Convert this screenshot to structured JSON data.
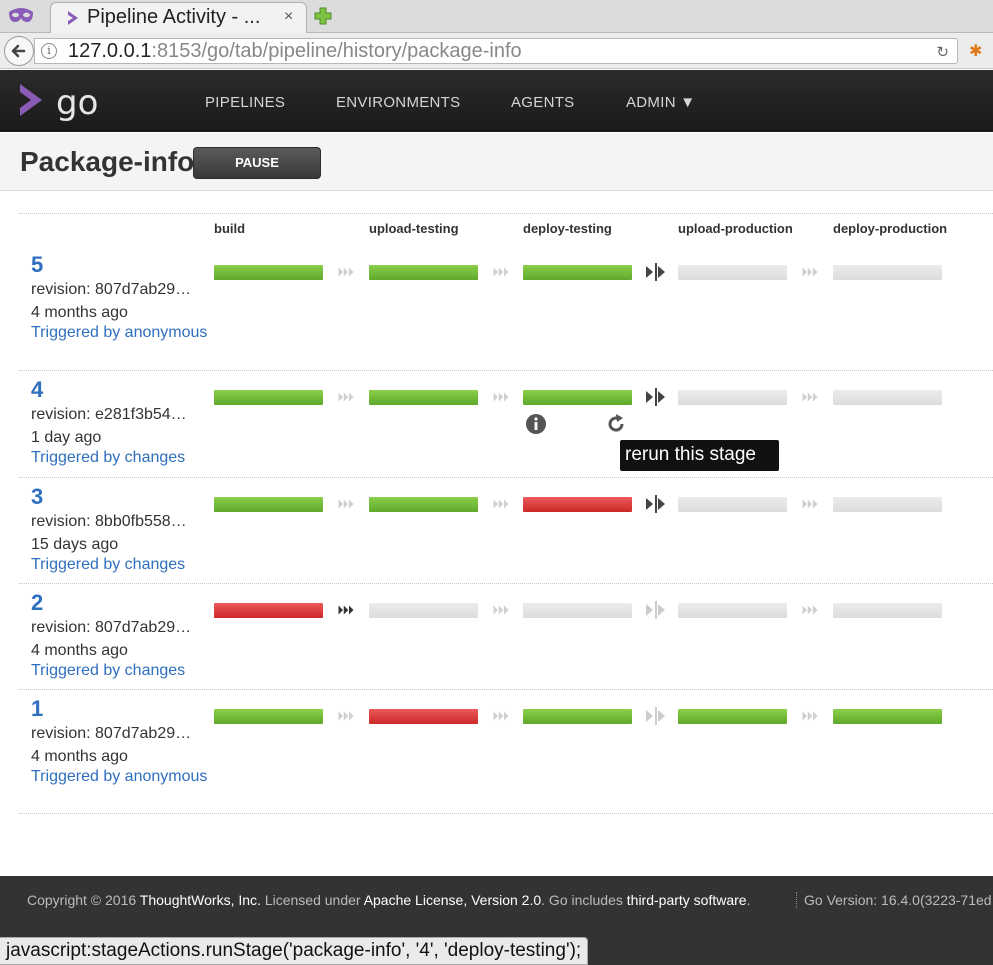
{
  "browser": {
    "tab_title": "Pipeline Activity - ...",
    "tab_close": "×",
    "url_host": "127.0.0.1",
    "url_rest": ":8153/go/tab/pipeline/history/package-info",
    "status_url": "javascript:stageActions.runStage('package-info', '4', 'deploy-testing');"
  },
  "header": {
    "logo_text": "go",
    "nav": [
      "PIPELINES",
      "ENVIRONMENTS",
      "AGENTS",
      "ADMIN ▼"
    ]
  },
  "page": {
    "title": "Package-info",
    "pause_label": "PAUSE"
  },
  "stages": [
    "build",
    "upload-testing",
    "deploy-testing",
    "upload-production",
    "deploy-production"
  ],
  "runs": [
    {
      "counter": "5",
      "revision": "revision: 807d7ab29…",
      "ago": "4 months ago",
      "triggered": "Triggered by anonymous",
      "results": [
        "passed",
        "passed",
        "passed",
        "pending",
        "pending"
      ],
      "arrows": [
        "auto",
        "auto",
        "manual",
        "auto"
      ]
    },
    {
      "counter": "4",
      "revision": "revision: e281f3b54…",
      "ago": "1 day ago",
      "triggered": "Triggered by changes",
      "results": [
        "passed",
        "passed",
        "passed",
        "pending",
        "pending"
      ],
      "arrows": [
        "auto",
        "auto",
        "manual",
        "auto"
      ]
    },
    {
      "counter": "3",
      "revision": "revision: 8bb0fb558…",
      "ago": "15 days ago",
      "triggered": "Triggered by changes",
      "results": [
        "passed",
        "passed",
        "failed",
        "pending",
        "pending"
      ],
      "arrows": [
        "auto",
        "auto",
        "manual",
        "auto"
      ]
    },
    {
      "counter": "2",
      "revision": "revision: 807d7ab29…",
      "ago": "4 months ago",
      "triggered": "Triggered by changes",
      "results": [
        "failed",
        "pending",
        "pending",
        "pending",
        "pending"
      ],
      "arrows": [
        "auto-active",
        "auto",
        "manual-faded",
        "auto"
      ]
    },
    {
      "counter": "1",
      "revision": "revision: 807d7ab29…",
      "ago": "4 months ago",
      "triggered": "Triggered by anonymous",
      "results": [
        "passed",
        "failed",
        "passed",
        "passed",
        "passed"
      ],
      "arrows": [
        "auto",
        "auto",
        "manual-faded",
        "auto"
      ]
    }
  ],
  "tooltip": {
    "text": "rerun this stage"
  },
  "footer": {
    "copyright": "Copyright © 2016 ",
    "company": "ThoughtWorks, Inc.",
    "licensed": " Licensed under ",
    "license": "Apache License, Version 2.0",
    "includes": ". Go includes ",
    "third_party": "third-party software",
    "period": ".",
    "version": "Go Version: 16.4.0(3223-71ed"
  },
  "colors": {
    "passed": "#6cb33e",
    "failed": "#d63a3a",
    "pending": "#e2e2e2",
    "link": "#2f6fbf",
    "tooltip_bg": "#111111"
  }
}
